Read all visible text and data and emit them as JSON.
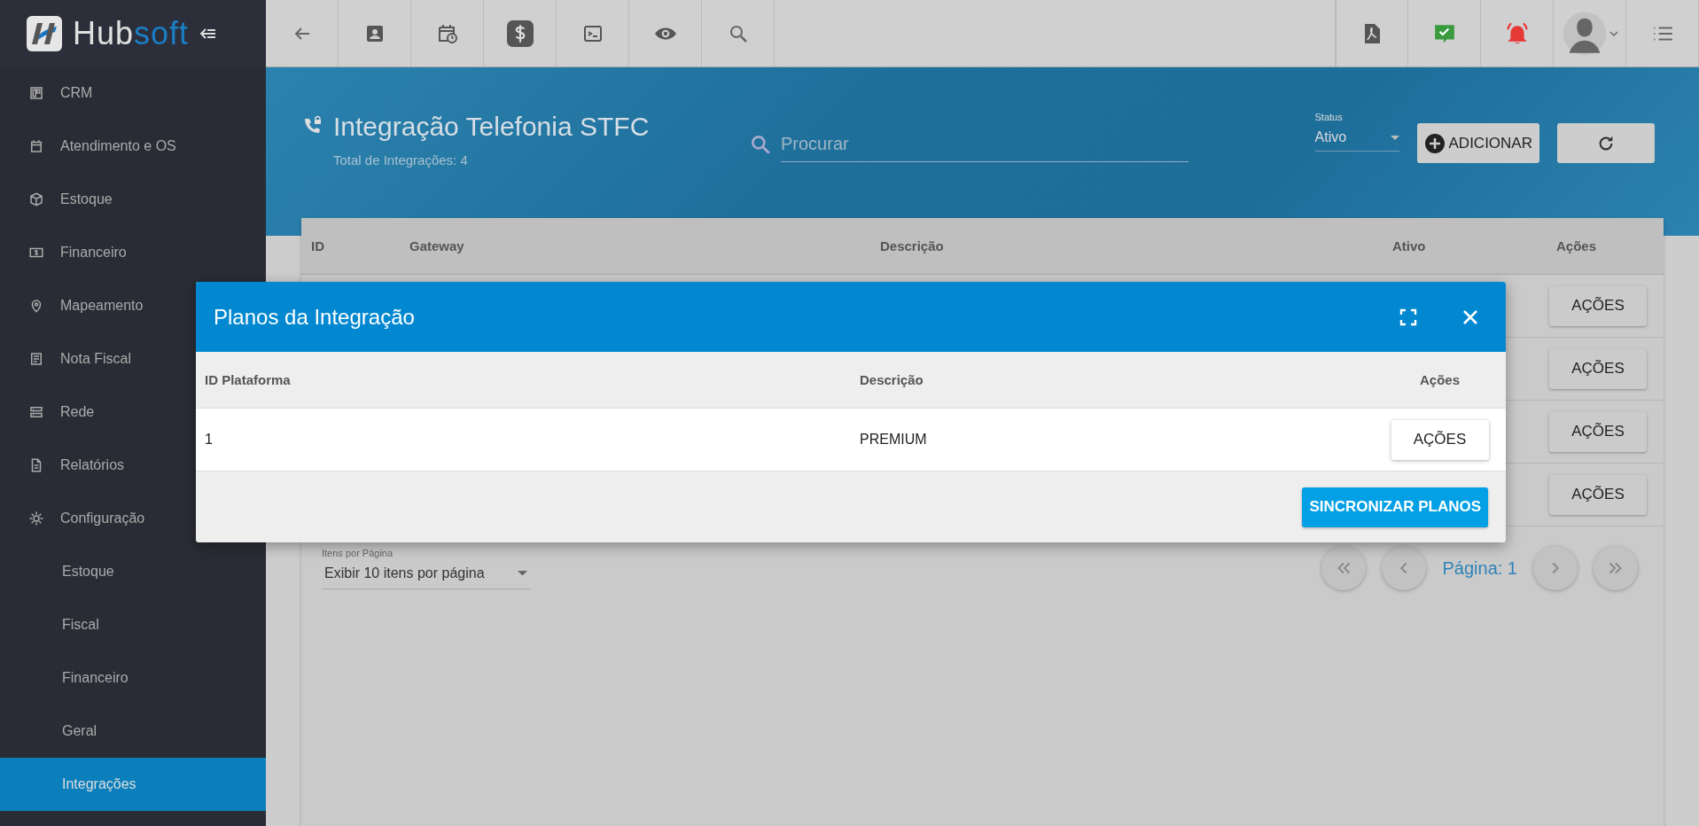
{
  "logo": {
    "text_a": "Hub",
    "text_b": "soft"
  },
  "sidebar": {
    "items": [
      {
        "label": "CRM",
        "selected": false
      },
      {
        "label": "Atendimento e OS",
        "selected": false
      },
      {
        "label": "Estoque",
        "selected": false
      },
      {
        "label": "Financeiro",
        "selected": false
      },
      {
        "label": "Mapeamento",
        "selected": false
      },
      {
        "label": "Nota Fiscal",
        "selected": false
      },
      {
        "label": "Rede",
        "selected": false
      },
      {
        "label": "Relatórios",
        "selected": false
      },
      {
        "label": "Configuração",
        "selected": false,
        "children": [
          {
            "label": "Estoque",
            "selected": false
          },
          {
            "label": "Fiscal",
            "selected": false
          },
          {
            "label": "Financeiro",
            "selected": false
          },
          {
            "label": "Geral",
            "selected": false
          },
          {
            "label": "Integrações",
            "selected": true
          }
        ]
      }
    ]
  },
  "page": {
    "title": "Integração Telefonia STFC",
    "subtitle": "Total de Integrações: 4",
    "search": {
      "placeholder": "Procurar"
    },
    "status": {
      "label": "Status",
      "value": "Ativo"
    },
    "add_button": "ADICIONAR"
  },
  "table": {
    "columns": [
      "ID",
      "Gateway",
      "Descrição",
      "Ativo",
      "Ações"
    ],
    "rows": [
      {
        "action": "AÇÕES"
      },
      {
        "action": "AÇÕES"
      },
      {
        "action": "AÇÕES"
      },
      {
        "action": "AÇÕES"
      }
    ]
  },
  "pager": {
    "per_page_label": "Itens por Página",
    "per_page_value": "Exibir 10 itens por página",
    "page": "Página: 1"
  },
  "modal": {
    "title": "Planos da Integração",
    "columns": [
      "ID Plataforma",
      "Descrição",
      "Ações"
    ],
    "rows": [
      {
        "id": "1",
        "description": "PREMIUM",
        "action": "AÇÕES"
      }
    ],
    "sync_button": "SINCRONIZAR PLANOS"
  }
}
